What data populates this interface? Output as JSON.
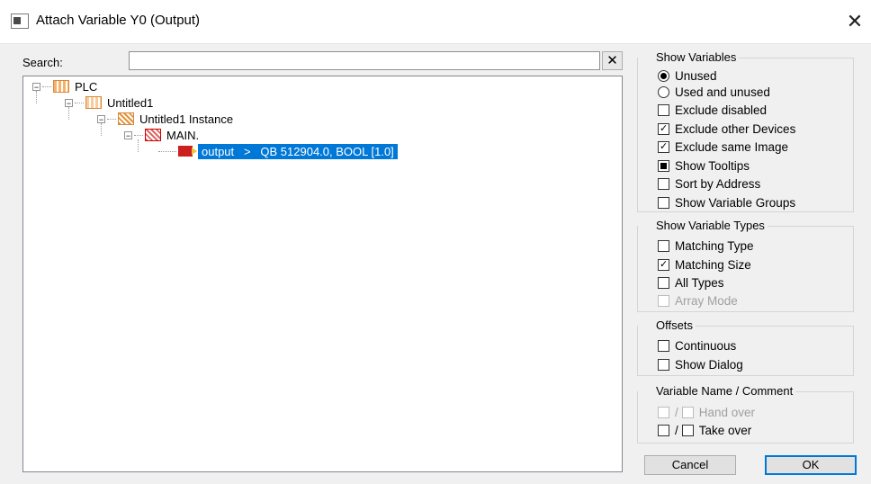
{
  "window": {
    "title": "Attach Variable Y0 (Output)",
    "close_label": "✕"
  },
  "search": {
    "label": "Search:",
    "value": "",
    "clear_label": "✕"
  },
  "tree": {
    "plc": "PLC",
    "project": "Untitled1",
    "instance": "Untitled1 Instance",
    "main": "MAIN.",
    "variable": "output   >   QB 512904.0, BOOL [1.0]",
    "expander": "−"
  },
  "show_variables": {
    "legend": "Show Variables",
    "unused": "Unused",
    "used_and_unused": "Used and unused",
    "exclude_disabled": "Exclude disabled",
    "exclude_other_devices": "Exclude other Devices",
    "exclude_same_image": "Exclude same Image",
    "show_tooltips": "Show Tooltips",
    "sort_by_address": "Sort by Address",
    "show_variable_groups": "Show Variable Groups"
  },
  "show_variable_types": {
    "legend": "Show Variable Types",
    "matching_type": "Matching Type",
    "matching_size": "Matching Size",
    "all_types": "All Types",
    "array_mode": "Array Mode"
  },
  "offsets": {
    "legend": "Offsets",
    "continuous": "Continuous",
    "show_dialog": "Show Dialog"
  },
  "variable_name_comment": {
    "legend": "Variable Name / Comment",
    "slash": "/",
    "hand_over": "Hand over",
    "take_over": "Take over"
  },
  "buttons": {
    "cancel": "Cancel",
    "ok": "OK"
  },
  "colors": {
    "selection": "#0078d7"
  }
}
